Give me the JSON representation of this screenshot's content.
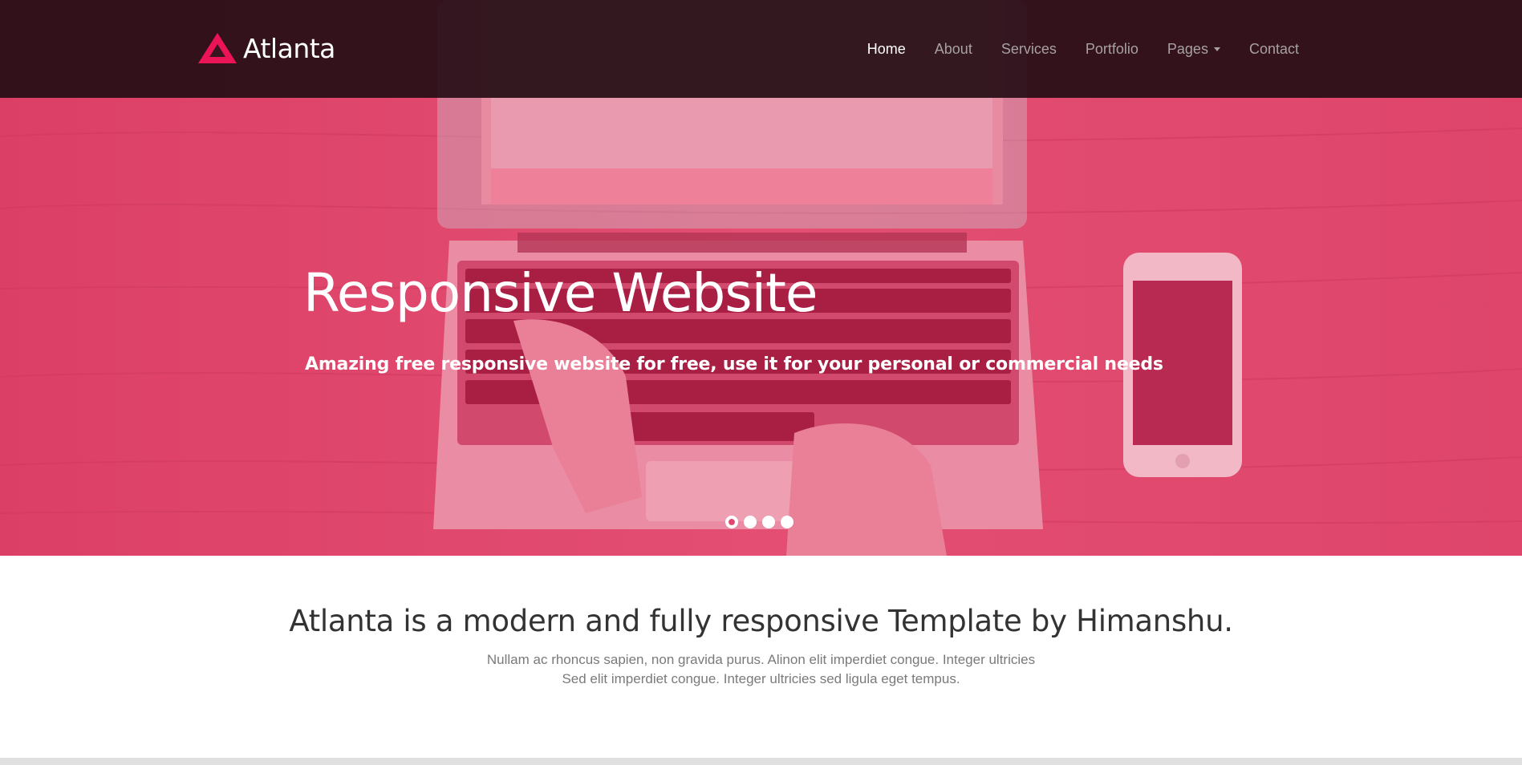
{
  "brand": {
    "name": "Atlanta",
    "logo_icon": "triangle-logo-icon",
    "accent": "#e8124f"
  },
  "nav": {
    "items": [
      {
        "label": "Home",
        "active": true
      },
      {
        "label": "About"
      },
      {
        "label": "Services"
      },
      {
        "label": "Portfolio"
      },
      {
        "label": "Pages",
        "dropdown": true
      },
      {
        "label": "Contact"
      }
    ]
  },
  "hero": {
    "title": "Responsive Website",
    "subtitle": "Amazing free responsive website for free, use it for your personal or commercial needs",
    "overlay_color": "#e1476c",
    "background_icon": "laptop-phone-photo",
    "slides": 4,
    "active_slide": 1
  },
  "intro": {
    "heading": "Atlanta is a modern and fully responsive Template by Himanshu.",
    "line1": "Nullam ac rhoncus sapien, non gravida purus. Alinon elit imperdiet congue. Integer ultricies",
    "line2": "Sed elit imperdiet congue. Integer ultricies sed ligula eget tempus."
  }
}
